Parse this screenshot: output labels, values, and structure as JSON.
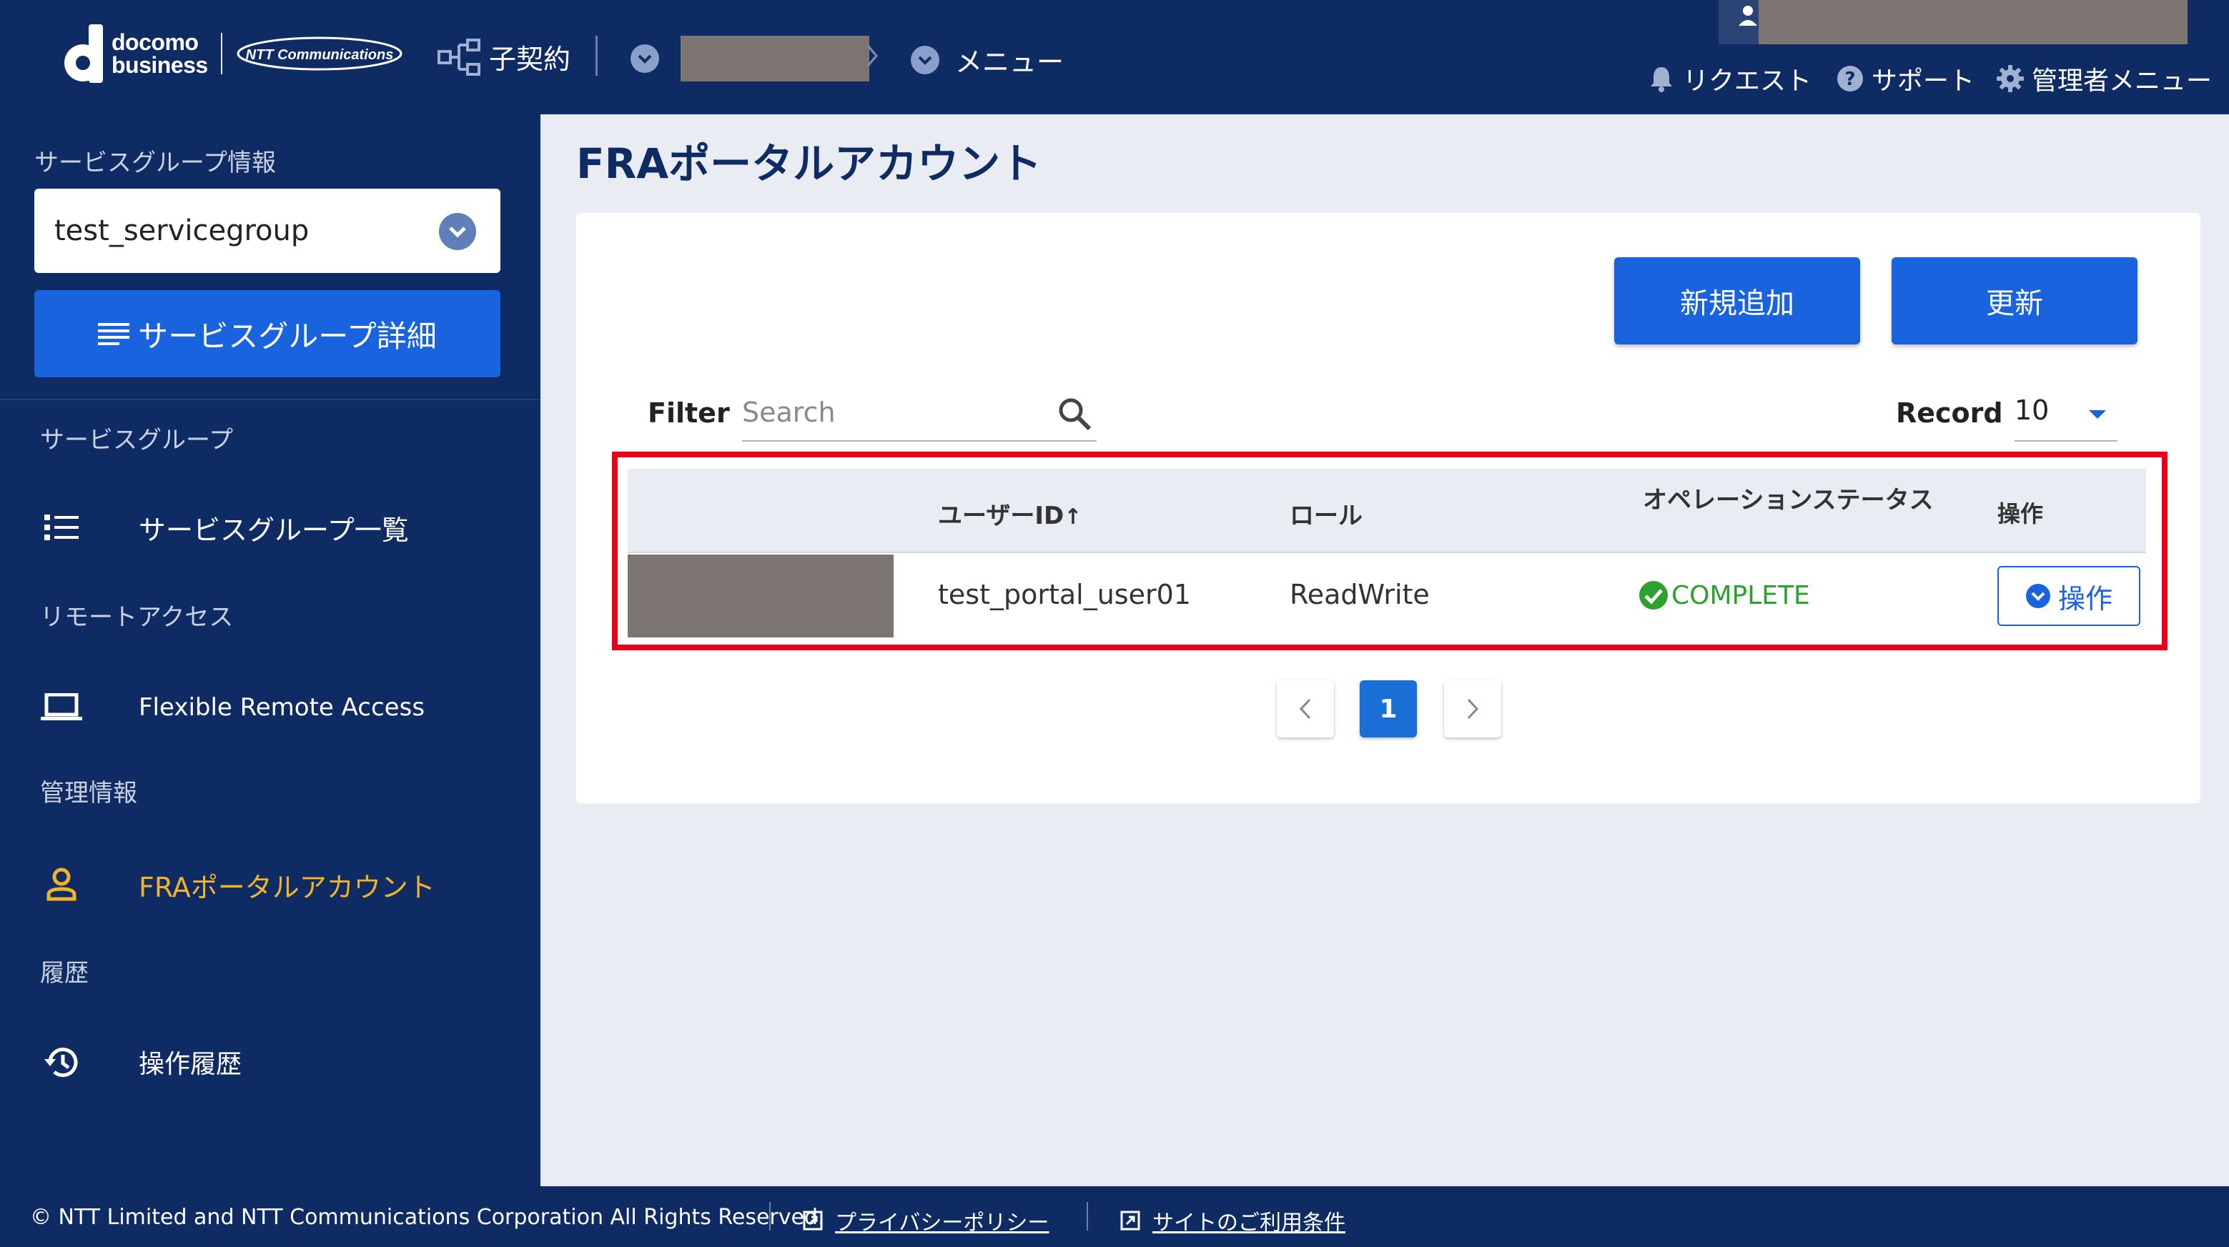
{
  "header": {
    "logo_line1": "docomo",
    "logo_line2": "business",
    "ntt_logo_text": "NTT Communications",
    "contract_label": "子契約",
    "menu_label": "メニュー",
    "request_label": "リクエスト",
    "support_label": "サポート",
    "admin_menu_label": "管理者メニュー"
  },
  "sidebar": {
    "service_group_info_label": "サービスグループ情報",
    "selected_service_group": "test_servicegroup",
    "service_group_detail_button": "サービスグループ詳細",
    "sections": [
      {
        "heading": "サービスグループ",
        "item": "サービスグループ一覧",
        "icon": "list-icon"
      },
      {
        "heading": "リモートアクセス",
        "item": "Flexible Remote Access",
        "icon": "laptop-icon"
      },
      {
        "heading": "管理情報",
        "item": "FRAポータルアカウント",
        "icon": "user-icon"
      },
      {
        "heading": "履歴",
        "item": "操作履歴",
        "icon": "history-icon"
      }
    ]
  },
  "main": {
    "title": "FRAポータルアカウント",
    "add_button": "新規追加",
    "refresh_button": "更新",
    "filter_label": "Filter",
    "search_placeholder": "Search",
    "record_label": "Record",
    "record_value": "10",
    "table": {
      "headers": [
        "ユーザーID",
        "ロール",
        "オペレーションステータス",
        "操作"
      ],
      "sort_indicator": "↑",
      "rows": [
        {
          "user_id": "test_portal_user01",
          "role": "ReadWrite",
          "status": "COMPLETE",
          "action": "操作"
        }
      ]
    },
    "pagination": {
      "current_page": "1"
    }
  },
  "footer": {
    "copyright": "© NTT Limited and NTT Communications Corporation All Rights Reserved.",
    "privacy_link": "プライバシーポリシー",
    "terms_link": "サイトのご利用条件"
  },
  "colors": {
    "navy": "#0e2b63",
    "primary_blue": "#1a63de",
    "active_nav": "#f0b429",
    "status_green": "#2da12d",
    "highlight_red": "#e8001b"
  }
}
